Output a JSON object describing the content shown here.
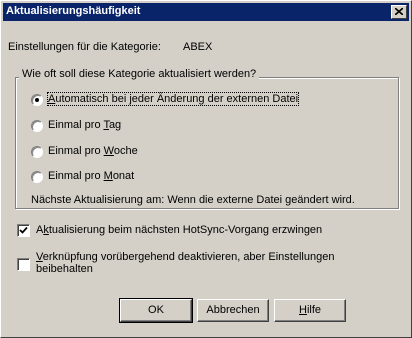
{
  "window": {
    "title": "Aktualisierungshäufigkeit",
    "close_label": "X"
  },
  "category": {
    "label": "Einstellungen für die Kategorie:",
    "value": "ABEX"
  },
  "group": {
    "legend": "Wie oft soll diese Kategorie aktualisiert werden?",
    "options": [
      {
        "pre": "",
        "key": "A",
        "post": "utomatisch bei jeder Änderung der externen Datei",
        "selected": true
      },
      {
        "pre": "Einmal pro ",
        "key": "T",
        "post": "ag",
        "selected": false
      },
      {
        "pre": "Einmal pro ",
        "key": "W",
        "post": "oche",
        "selected": false
      },
      {
        "pre": "Einmal pro ",
        "key": "M",
        "post": "onat",
        "selected": false
      }
    ],
    "next_update": "Nächste Aktualisierung am:  Wenn die externe Datei geändert wird."
  },
  "force_hotsync": {
    "pre": "A",
    "key": "k",
    "post": "tualisierung beim nächsten HotSync-Vorgang erzwingen",
    "checked": true
  },
  "disable_link": {
    "key": "V",
    "line1": "erknüpfung vorübergehend deaktivieren, aber Einstellungen",
    "line2": "beibehalten",
    "checked": false
  },
  "buttons": {
    "ok": "OK",
    "cancel": "Abbrechen",
    "help_key": "H",
    "help_rest": "ilfe"
  }
}
